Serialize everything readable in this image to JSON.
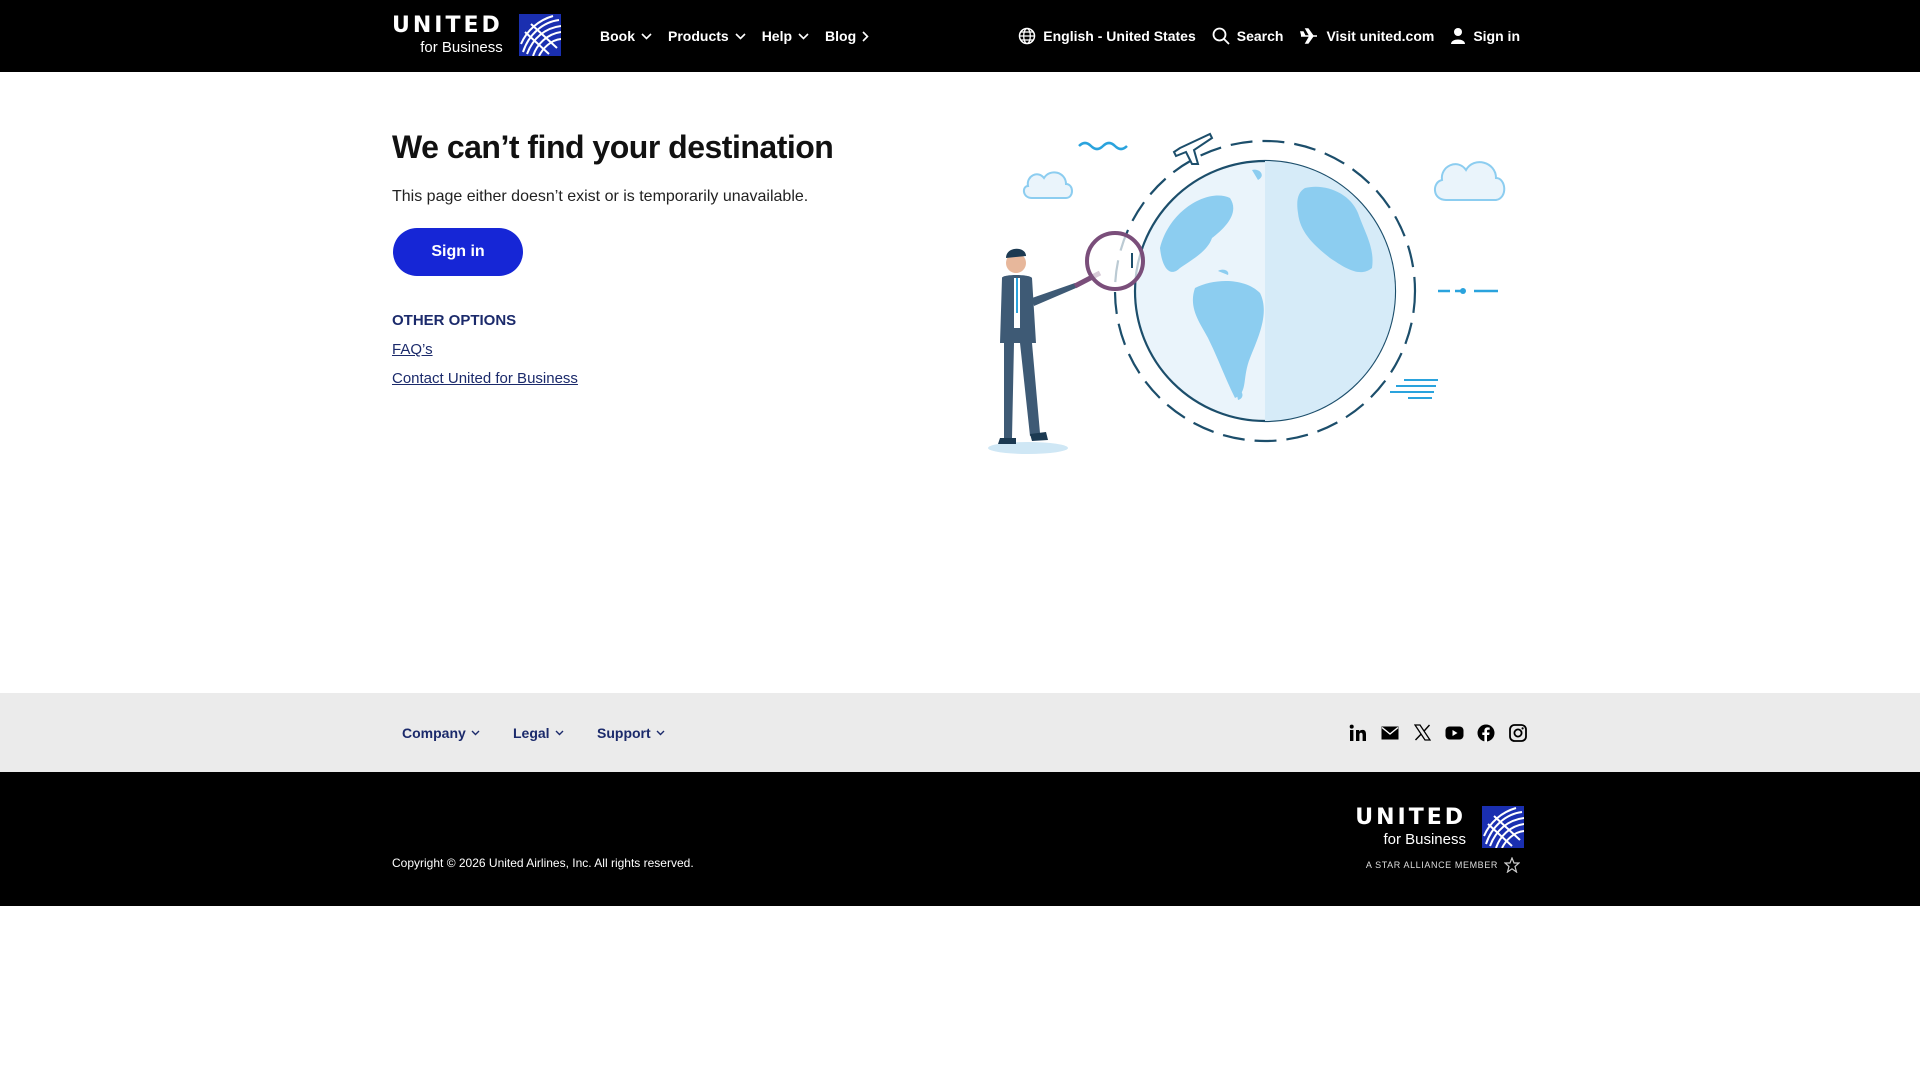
{
  "header": {
    "logo_primary": "UNITED",
    "logo_secondary": "for Business",
    "nav": [
      {
        "label": "Book"
      },
      {
        "label": "Products"
      },
      {
        "label": "Help"
      },
      {
        "label": "Blog"
      }
    ],
    "language": "English - United States",
    "search": "Search",
    "visit": "Visit united.com",
    "signin": "Sign in"
  },
  "main": {
    "title": "We can’t find your destination",
    "subtitle": "This page either doesn’t exist or is temporarily unavailable.",
    "signin_button": "Sign in",
    "other_heading": "OTHER OPTIONS",
    "links": [
      {
        "label": "FAQ’s"
      },
      {
        "label": "Contact United for Business"
      }
    ]
  },
  "footer": {
    "nav": [
      {
        "label": "Company"
      },
      {
        "label": "Legal"
      },
      {
        "label": "Support"
      }
    ],
    "socials": [
      "linkedin-icon",
      "email-icon",
      "x-icon",
      "youtube-icon",
      "facebook-icon",
      "instagram-icon"
    ],
    "copyright": "Copyright © 2026 United Airlines, Inc. All rights reserved.",
    "logo_primary": "UNITED",
    "logo_secondary": "for Business",
    "star_alliance": "A STAR ALLIANCE MEMBER"
  },
  "colors": {
    "header_bg": "#000000",
    "primary_button": "#1626d6",
    "link": "#1b2a6b",
    "footer_nav_bg": "#ebebeb",
    "globe_blue": "#1a2fb0",
    "illustration_light_blue": "#8ccdf0"
  }
}
